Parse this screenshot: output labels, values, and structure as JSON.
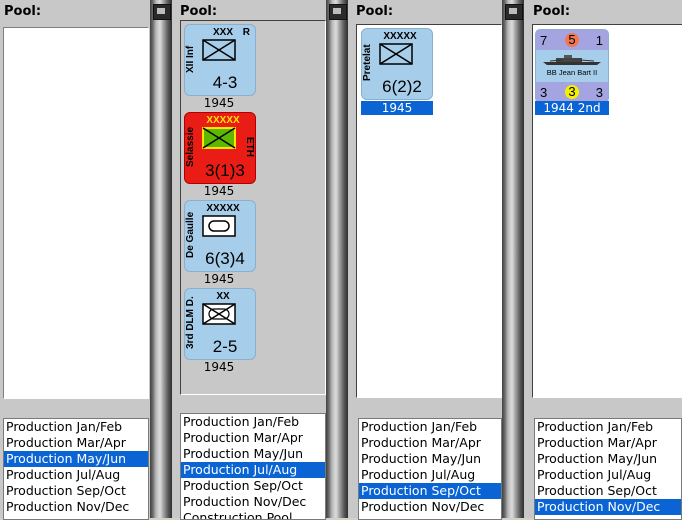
{
  "pools": [
    {
      "label": "Pool:",
      "list": [
        "Production Jan/Feb",
        "Production Mar/Apr",
        "Production May/Jun",
        "Production Jul/Aug",
        "Production Sep/Oct",
        "Production Nov/Dec"
      ],
      "selected_index": 2
    },
    {
      "label": "Pool:",
      "counters": [
        {
          "name": "XII Inf",
          "size": "XXX",
          "corner": "R",
          "strength": "4-3",
          "year": "1945"
        },
        {
          "name": "Selassie",
          "size": "XXXXX",
          "side": "ETH",
          "strength": "3(1)3",
          "year": "1945"
        },
        {
          "name": "De Gaulle",
          "size": "XXXXX",
          "strength": "6(3)4",
          "year": "1945"
        },
        {
          "name": "3rd DLM D.",
          "size": "XX",
          "strength": "2-5",
          "year": "1945"
        }
      ],
      "list": [
        "Production Jan/Feb",
        "Production Mar/Apr",
        "Production May/Jun",
        "Production Jul/Aug",
        "Production Sep/Oct",
        "Production Nov/Dec",
        "Construction Pool"
      ],
      "selected_index": 3
    },
    {
      "label": "Pool:",
      "counters": [
        {
          "name": "Pretelat",
          "size": "XXXXX",
          "strength": "6(2)2",
          "year": "1945"
        }
      ],
      "list": [
        "Production Jan/Feb",
        "Production Mar/Apr",
        "Production May/Jun",
        "Production Jul/Aug",
        "Production Sep/Oct",
        "Production Nov/Dec"
      ],
      "selected_index": 4
    },
    {
      "label": "Pool:",
      "ship": {
        "tl": "7",
        "tc": "5",
        "tr": "1",
        "name": "BB Jean Bart II",
        "bl": "3",
        "bc": "3",
        "br": "3",
        "year": "1944 2nd"
      },
      "list": [
        "Production Jan/Feb",
        "Production Mar/Apr",
        "Production May/Jun",
        "Production Jul/Aug",
        "Production Sep/Oct",
        "Production Nov/Dec"
      ],
      "selected_index": 5
    }
  ]
}
